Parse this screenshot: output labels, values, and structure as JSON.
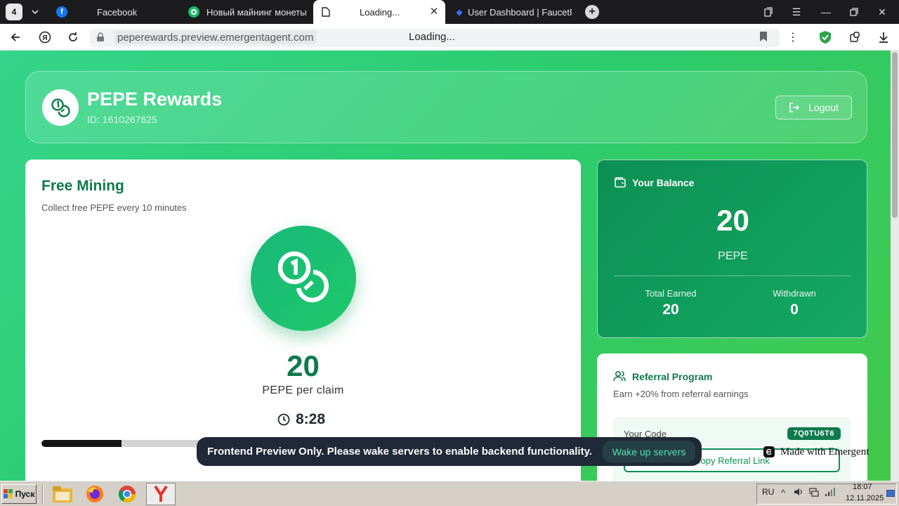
{
  "browser": {
    "tab_count": "4",
    "tabs": [
      {
        "label": "Facebook",
        "favicon": "facebook-icon",
        "color": "#1877f2"
      },
      {
        "label": "Новый майнинг монеты P",
        "favicon": "target-icon",
        "color": "#1fb86a"
      },
      {
        "label": "Loading...",
        "favicon": "page-icon",
        "active": true
      },
      {
        "label": "User Dashboard | FaucetPa",
        "favicon": "diamond-icon",
        "color": "#3b6ef5"
      }
    ],
    "url": "peperewards.preview.emergentagent.com",
    "page_title": "Loading..."
  },
  "header": {
    "title": "PEPE Rewards",
    "user_id": "ID: 1610267625",
    "logout_label": "Logout"
  },
  "mining": {
    "title": "Free Mining",
    "subtitle": "Collect free PEPE every 10 minutes",
    "amount": "20",
    "unit": "PEPE per claim",
    "timer": "8:28",
    "progress_fraction": 0.153
  },
  "balance": {
    "title": "Your Balance",
    "value": "20",
    "unit": "PEPE",
    "total_earned_label": "Total Earned",
    "total_earned": "20",
    "withdrawn_label": "Withdrawn",
    "withdrawn": "0"
  },
  "referral": {
    "title": "Referral Program",
    "subtitle": "Earn +20% from referral earnings",
    "code_label": "Your Code",
    "code": "7Q0TU6T6",
    "copy_label": "Copy Referral Link"
  },
  "toast": {
    "message": "Frontend Preview Only. Please wake servers to enable backend functionality.",
    "button": "Wake up servers"
  },
  "badge": {
    "label": "Made with Emergent"
  },
  "taskbar": {
    "start_label": "Пуск",
    "language": "RU",
    "time": "18:07",
    "date": "12.11.2025"
  },
  "colors": {
    "primary_green": "#0f7a4d",
    "page_gradient_start": "#34d58a",
    "page_gradient_end": "#43c94a",
    "toast_bg": "#1f2937",
    "toast_button_text": "#52e0b6"
  }
}
